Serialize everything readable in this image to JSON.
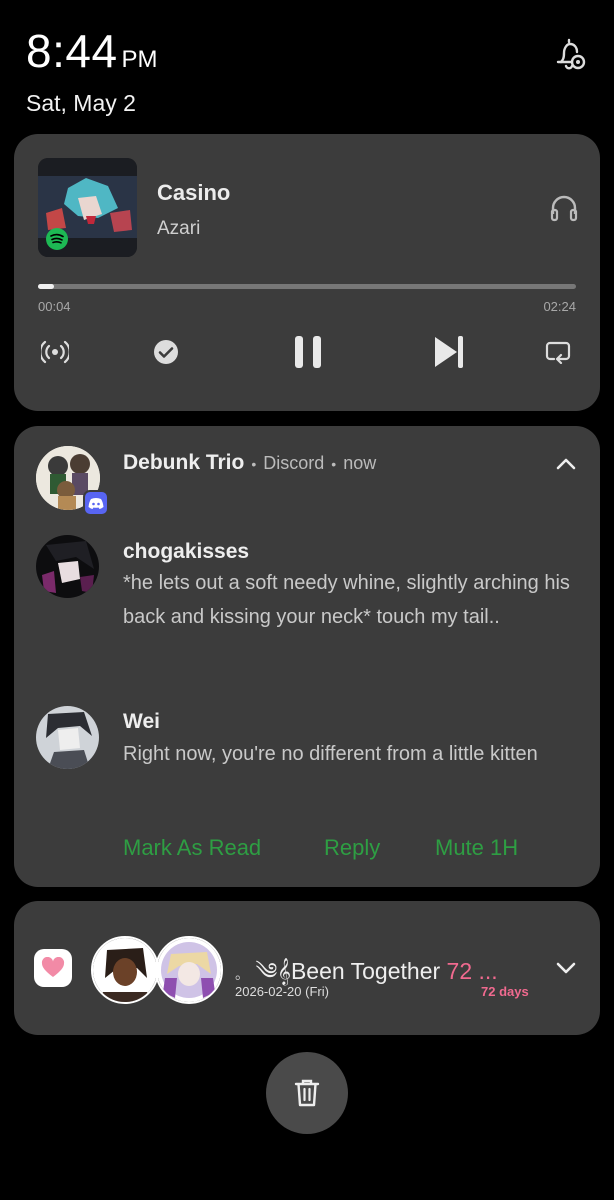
{
  "status": {
    "time": "8:44",
    "ampm": "PM",
    "date": "Sat, May 2",
    "icons": [
      "notification-settings-bell-icon"
    ]
  },
  "media": {
    "title": "Casino",
    "artist": "Azari",
    "elapsed": "00:04",
    "duration": "02:24",
    "progress": 0.03,
    "app_icon": "spotify-icon",
    "controls": [
      "broadcast-icon",
      "check-circle-icon",
      "pause-icon",
      "skip-next-icon",
      "repeat-icon"
    ],
    "output_icon": "headphones-icon"
  },
  "discord": {
    "group": "Debunk Trio",
    "app": "Discord",
    "time": "now",
    "messages": [
      {
        "author": "chogakisses",
        "text": "*he lets out a soft needy whine, slightly arching his back and kissing your neck* touch my tail.."
      },
      {
        "author": "Wei",
        "text": "Right now, you're no different from a little kitten"
      }
    ],
    "actions": {
      "mark_read": "Mark As Read",
      "reply": "Reply",
      "mute": "Mute 1H"
    },
    "accent": "#2e9e43"
  },
  "together": {
    "prefix": "。",
    "deco": "༄𝄞",
    "label": "Been Together",
    "days_short": "72 ...",
    "date": "2026-02-20 (Fri)",
    "count": "72 days",
    "accent": "#f06a8f"
  },
  "clear_icon": "trash-icon"
}
